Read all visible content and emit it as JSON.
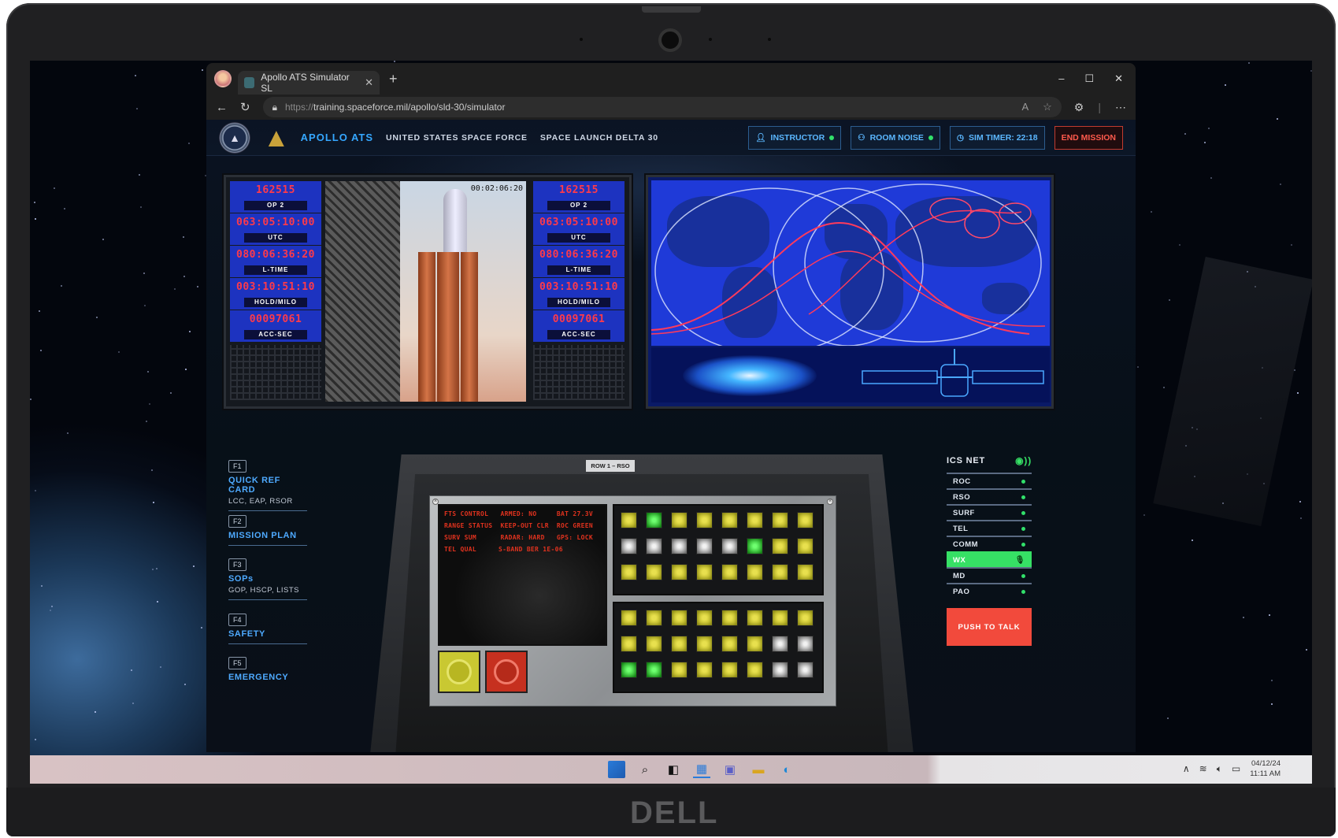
{
  "browser": {
    "tab_title": "Apollo ATS Simulator SL",
    "url_scheme": "https://",
    "url_rest": "training.spaceforce.mil/apollo/sld-30/simulator"
  },
  "header": {
    "brand": "APOLLO ATS",
    "org": "UNITED STATES SPACE FORCE",
    "unit": "SPACE LAUNCH DELTA 30",
    "instructor": "INSTRUCTOR",
    "room_noise": "ROOM NOISE",
    "sim_timer": "SIM TIMER: 22:18",
    "end_mission": "END MISSION"
  },
  "clocks": [
    {
      "value": "162515",
      "label": "OP 2"
    },
    {
      "value": "063:05:10:00",
      "label": "UTC"
    },
    {
      "value": "080:06:36:20",
      "label": "L-TIME"
    },
    {
      "value": "003:10:51:10",
      "label": "HOLD/MILO"
    },
    {
      "value": "00097061",
      "label": "ACC-SEC"
    }
  ],
  "video": {
    "timestamp": "00:02:06:20"
  },
  "fnav": [
    {
      "key": "F1",
      "title": "QUICK REF CARD",
      "sub": "LCC, EAP, RSOR"
    },
    {
      "key": "F2",
      "title": "MISSION PLAN",
      "sub": ""
    },
    {
      "key": "F3",
      "title": "SOPs",
      "sub": "GOP, HSCP, LISTS"
    },
    {
      "key": "F4",
      "title": "SAFETY",
      "sub": ""
    },
    {
      "key": "F5",
      "title": "EMERGENCY",
      "sub": ""
    }
  ],
  "console": {
    "row_label": "ROW 1 – RSO",
    "crt": [
      [
        "FTS CONTROL",
        "ARMED: NO",
        "BAT 27.3V"
      ],
      [
        "RANGE STATUS",
        "KEEP-OUT CLR",
        "ROC GREEN"
      ],
      [
        "SURV SUM",
        "RADAR: HARD",
        "GPS: LOCK"
      ],
      [
        "TEL QUAL",
        "S-BAND  BER 1E-06",
        ""
      ]
    ],
    "lights_top": [
      [
        "y",
        "g",
        "y",
        "y",
        "y",
        "y",
        "y",
        "y"
      ],
      [
        "w",
        "w",
        "w",
        "w",
        "w",
        "g",
        "y",
        "y"
      ],
      [
        "y",
        "y",
        "y",
        "y",
        "y",
        "y",
        "y",
        "y"
      ]
    ],
    "lights_bottom": [
      [
        "y",
        "y",
        "y",
        "y",
        "y",
        "y",
        "y",
        "y"
      ],
      [
        "y",
        "y",
        "y",
        "y",
        "y",
        "y",
        "w",
        "w"
      ],
      [
        "g",
        "g",
        "y",
        "y",
        "y",
        "y",
        "w",
        "w"
      ]
    ]
  },
  "ics": {
    "title": "ICS NET",
    "items": [
      {
        "label": "ROC",
        "active": false
      },
      {
        "label": "RSO",
        "active": false
      },
      {
        "label": "SURF",
        "active": false
      },
      {
        "label": "TEL",
        "active": false
      },
      {
        "label": "COMM",
        "active": false
      },
      {
        "label": "WX",
        "active": true
      },
      {
        "label": "MD",
        "active": false
      },
      {
        "label": "PAO",
        "active": false
      }
    ],
    "push_to_talk": "PUSH TO TALK"
  },
  "taskbar": {
    "date": "04/12/24",
    "time": "11:11 AM"
  },
  "device": {
    "brand": "DELL"
  },
  "colors": {
    "accent": "#35a7ff",
    "active_green": "#36e065",
    "alert_red": "#f24a3c"
  }
}
